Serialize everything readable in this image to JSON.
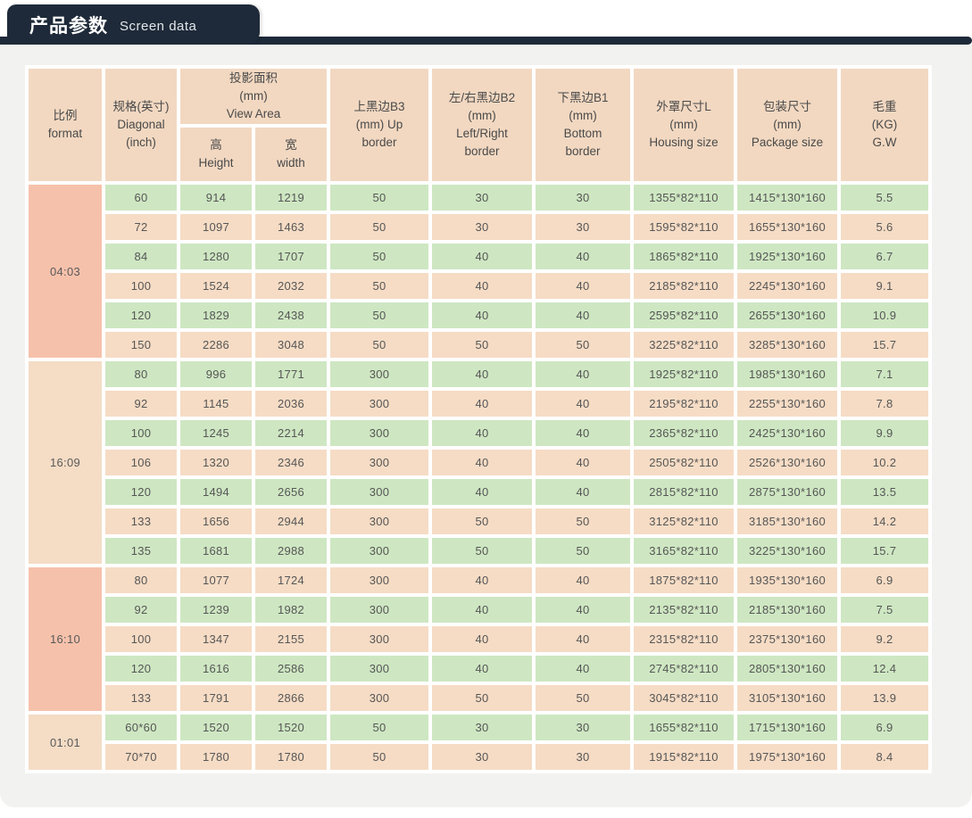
{
  "header": {
    "title_zh": "产品参数",
    "title_en": "Screen data"
  },
  "colors": {
    "navy": "#1e2a39",
    "panel_grey": "#f2f2f0",
    "header_peach": "#f2d8c1",
    "row_peach": "#f6dcc5",
    "row_green": "#cee7c2",
    "format_salmon": "#f6c1ab",
    "format_light_peach": "#f4dcc5"
  },
  "table": {
    "headers": {
      "format": "比例\nformat",
      "diagonal": "规格(英寸)\nDiagonal\n(inch)",
      "view_area": "投影面积\n(mm)\nView Area",
      "height": "高\nHeight",
      "width": "宽\nwidth",
      "b3": "上黑边B3\n(mm)  Up\nborder",
      "b2": "左/右黑边B2\n(mm)\nLeft/Right\nborder",
      "b1": "下黑边B1\n(mm)\nBottom\nborder",
      "housing": "外罩尺寸L\n(mm)\nHousing size",
      "package": "包装尺寸\n(mm)\nPackage size",
      "gw": "毛重\n(KG)\nG.W"
    },
    "groups": [
      {
        "format": "04:03",
        "format_shade": "dark",
        "rows": [
          {
            "shade": "green",
            "diagonal": "60",
            "height": "914",
            "width": "1219",
            "b3": "50",
            "b2": "30",
            "b1": "30",
            "housing": "1355*82*110",
            "package": "1415*130*160",
            "gw": "5.5"
          },
          {
            "shade": "peach",
            "diagonal": "72",
            "height": "1097",
            "width": "1463",
            "b3": "50",
            "b2": "30",
            "b1": "30",
            "housing": "1595*82*110",
            "package": "1655*130*160",
            "gw": "5.6"
          },
          {
            "shade": "green",
            "diagonal": "84",
            "height": "1280",
            "width": "1707",
            "b3": "50",
            "b2": "40",
            "b1": "40",
            "housing": "1865*82*110",
            "package": "1925*130*160",
            "gw": "6.7"
          },
          {
            "shade": "peach",
            "diagonal": "100",
            "height": "1524",
            "width": "2032",
            "b3": "50",
            "b2": "40",
            "b1": "40",
            "housing": "2185*82*110",
            "package": "2245*130*160",
            "gw": "9.1"
          },
          {
            "shade": "green",
            "diagonal": "120",
            "height": "1829",
            "width": "2438",
            "b3": "50",
            "b2": "40",
            "b1": "40",
            "housing": "2595*82*110",
            "package": "2655*130*160",
            "gw": "10.9"
          },
          {
            "shade": "peach",
            "diagonal": "150",
            "height": "2286",
            "width": "3048",
            "b3": "50",
            "b2": "50",
            "b1": "50",
            "housing": "3225*82*110",
            "package": "3285*130*160",
            "gw": "15.7"
          }
        ]
      },
      {
        "format": "16:09",
        "format_shade": "light",
        "rows": [
          {
            "shade": "green",
            "diagonal": "80",
            "height": "996",
            "width": "1771",
            "b3": "300",
            "b2": "40",
            "b1": "40",
            "housing": "1925*82*110",
            "package": "1985*130*160",
            "gw": "7.1"
          },
          {
            "shade": "peach",
            "diagonal": "92",
            "height": "1145",
            "width": "2036",
            "b3": "300",
            "b2": "40",
            "b1": "40",
            "housing": "2195*82*110",
            "package": "2255*130*160",
            "gw": "7.8"
          },
          {
            "shade": "green",
            "diagonal": "100",
            "height": "1245",
            "width": "2214",
            "b3": "300",
            "b2": "40",
            "b1": "40",
            "housing": "2365*82*110",
            "package": "2425*130*160",
            "gw": "9.9"
          },
          {
            "shade": "peach",
            "diagonal": "106",
            "height": "1320",
            "width": "2346",
            "b3": "300",
            "b2": "40",
            "b1": "40",
            "housing": "2505*82*110",
            "package": "2526*130*160",
            "gw": "10.2"
          },
          {
            "shade": "green",
            "diagonal": "120",
            "height": "1494",
            "width": "2656",
            "b3": "300",
            "b2": "40",
            "b1": "40",
            "housing": "2815*82*110",
            "package": "2875*130*160",
            "gw": "13.5"
          },
          {
            "shade": "peach",
            "diagonal": "133",
            "height": "1656",
            "width": "2944",
            "b3": "300",
            "b2": "50",
            "b1": "50",
            "housing": "3125*82*110",
            "package": "3185*130*160",
            "gw": "14.2"
          },
          {
            "shade": "green",
            "diagonal": "135",
            "height": "1681",
            "width": "2988",
            "b3": "300",
            "b2": "50",
            "b1": "50",
            "housing": "3165*82*110",
            "package": "3225*130*160",
            "gw": "15.7"
          }
        ]
      },
      {
        "format": "16:10",
        "format_shade": "dark",
        "rows": [
          {
            "shade": "peach",
            "diagonal": "80",
            "height": "1077",
            "width": "1724",
            "b3": "300",
            "b2": "40",
            "b1": "40",
            "housing": "1875*82*110",
            "package": "1935*130*160",
            "gw": "6.9"
          },
          {
            "shade": "green",
            "diagonal": "92",
            "height": "1239",
            "width": "1982",
            "b3": "300",
            "b2": "40",
            "b1": "40",
            "housing": "2135*82*110",
            "package": "2185*130*160",
            "gw": "7.5"
          },
          {
            "shade": "peach",
            "diagonal": "100",
            "height": "1347",
            "width": "2155",
            "b3": "300",
            "b2": "40",
            "b1": "40",
            "housing": "2315*82*110",
            "package": "2375*130*160",
            "gw": "9.2"
          },
          {
            "shade": "green",
            "diagonal": "120",
            "height": "1616",
            "width": "2586",
            "b3": "300",
            "b2": "40",
            "b1": "40",
            "housing": "2745*82*110",
            "package": "2805*130*160",
            "gw": "12.4"
          },
          {
            "shade": "peach",
            "diagonal": "133",
            "height": "1791",
            "width": "2866",
            "b3": "300",
            "b2": "50",
            "b1": "50",
            "housing": "3045*82*110",
            "package": "3105*130*160",
            "gw": "13.9"
          }
        ]
      },
      {
        "format": "01:01",
        "format_shade": "light",
        "rows": [
          {
            "shade": "green",
            "diagonal": "60*60",
            "height": "1520",
            "width": "1520",
            "b3": "50",
            "b2": "30",
            "b1": "30",
            "housing": "1655*82*110",
            "package": "1715*130*160",
            "gw": "6.9"
          },
          {
            "shade": "peach",
            "diagonal": "70*70",
            "height": "1780",
            "width": "1780",
            "b3": "50",
            "b2": "30",
            "b1": "30",
            "housing": "1915*82*110",
            "package": "1975*130*160",
            "gw": "8.4"
          }
        ]
      }
    ]
  }
}
